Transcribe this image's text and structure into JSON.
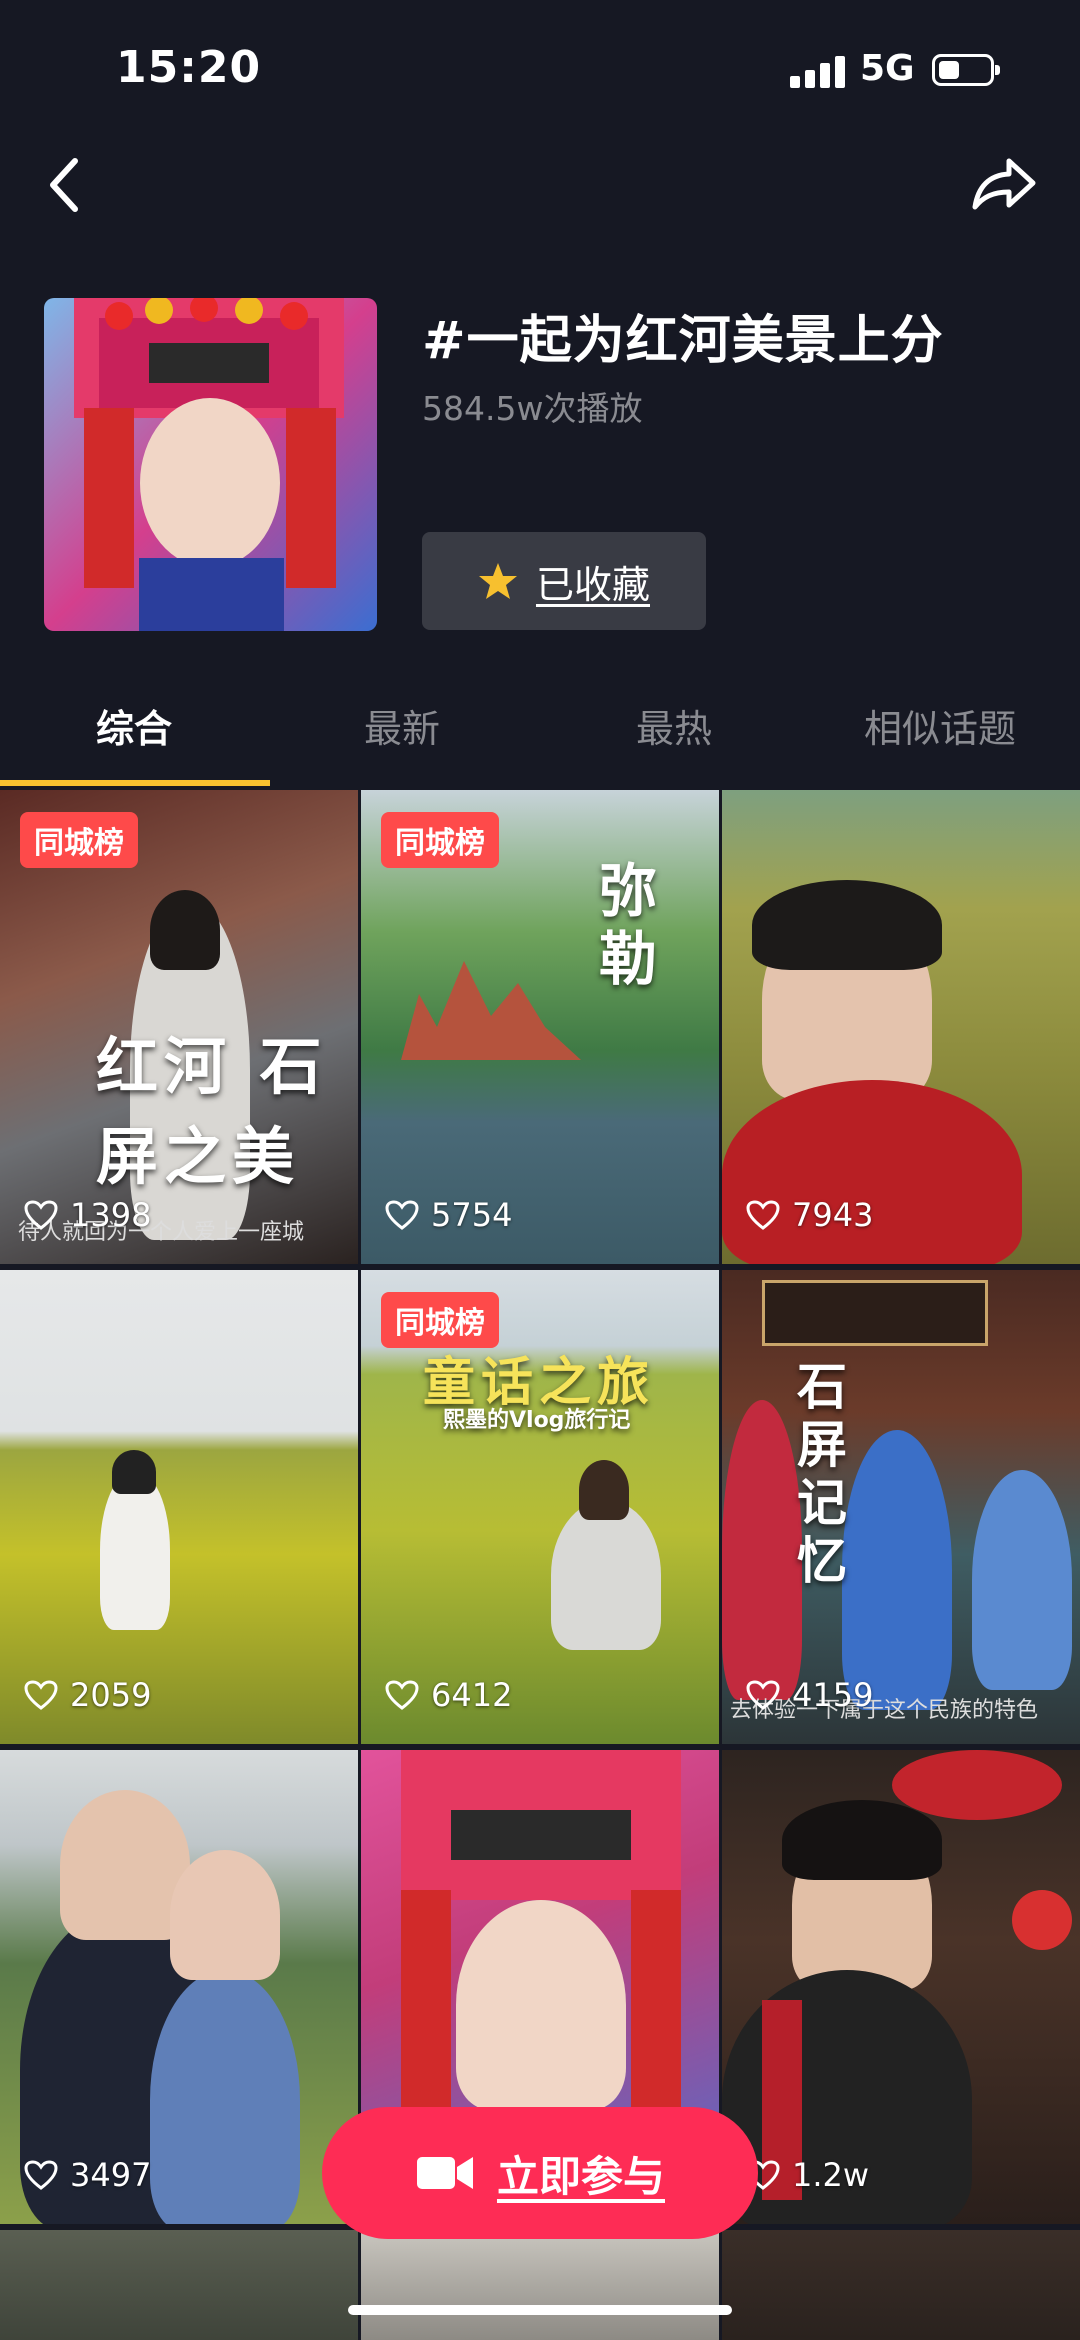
{
  "status": {
    "time": "15:20",
    "network": "5G",
    "battery_level": 0.4
  },
  "header": {
    "title": "#一起为红河美景上分",
    "plays": "584.5w次播放",
    "collect_label": "已收藏"
  },
  "tabs": [
    {
      "label": "综合",
      "active": true
    },
    {
      "label": "最新",
      "active": false
    },
    {
      "label": "最热",
      "active": false
    },
    {
      "label": "相似话题",
      "active": false
    }
  ],
  "videos": [
    {
      "badge": "同城榜",
      "likes": "1398",
      "overlay": "红河 石屏之美",
      "caption": "待人就回为一个人爱上一座城"
    },
    {
      "badge": "同城榜",
      "likes": "5754",
      "overlay": "弥勒"
    },
    {
      "badge": "",
      "likes": "7943"
    },
    {
      "badge": "",
      "likes": "2059"
    },
    {
      "badge": "同城榜",
      "likes": "6412",
      "overlay": "童话之旅",
      "subtitle": "熙墨的Vlog旅行记"
    },
    {
      "badge": "",
      "likes": "4159",
      "overlay": "石屏记忆",
      "caption": "去体验一下属于这个民族的特色"
    },
    {
      "badge": "",
      "likes": "3497"
    },
    {
      "badge": "",
      "likes": ""
    },
    {
      "badge": "",
      "likes": "1.2w"
    }
  ],
  "join_button": {
    "label": "立即参与"
  },
  "colors": {
    "background": "#161823",
    "accent": "#fe2c55",
    "tab_indicator": "#f7c02f",
    "badge": "#fe4a4a"
  }
}
